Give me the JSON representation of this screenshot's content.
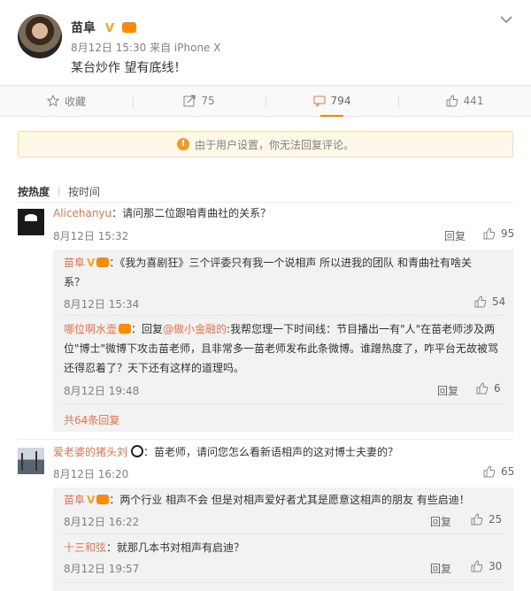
{
  "post": {
    "author": "苗阜",
    "meta": "8月12日 15:30 来自 iPhone X",
    "text": "某台炒作 望有底线！"
  },
  "actions": {
    "favorite": "收藏",
    "repost": "75",
    "comment": "794",
    "like": "441"
  },
  "notice": "由于用户设置，你无法回复评论。",
  "sort": {
    "hot": "按热度",
    "time": "按时间"
  },
  "reply_label": "回复",
  "comments": [
    {
      "user": "Alicehanyu",
      "text": "：请问那二位跟咱青曲社的关系？",
      "time": "8月12日 15:32",
      "likes": "95",
      "replies": [
        {
          "user": "苗阜",
          "text": "：《我为喜剧狂》三个评委只有我一个说相声 所以进我的团队 和青曲社有啥关",
          "text2": "系？",
          "time": "8月12日 15:34",
          "likes": "54"
        },
        {
          "user": "哪位啊水壶",
          "text_a": "：回复",
          "mention": "@做小金融的",
          "text_b": ":我帮您理一下时间线：节目播出一有\"人\"在苗老师涉及两",
          "text2": "位\"博士\"微博下攻击苗老师，且非常多一苗老师发布此条微博。谁蹭热度了，咋平台无故被骂",
          "text3": "还得忍着了？天下还有这样的道理吗。",
          "time": "8月12日 19:48",
          "likes": "6"
        }
      ],
      "more": "共64条回复"
    },
    {
      "user": "爱老婆的猪头刘",
      "text": "：苗老师，请问您怎么看新语相声的这对博士夫妻的？",
      "time": "8月12日 16:20",
      "likes": "65",
      "replies": [
        {
          "user": "苗阜",
          "text": "：两个行业 相声不会 但是对相声爱好者尤其是愿意这相声的朋友 有些启迪！",
          "time": "8月12日 16:22",
          "likes": "25"
        },
        {
          "user": "十三和弦",
          "text": "：就那几本书对相声有启迪？",
          "time": "8月12日 19:57",
          "likes": "30"
        }
      ]
    }
  ]
}
